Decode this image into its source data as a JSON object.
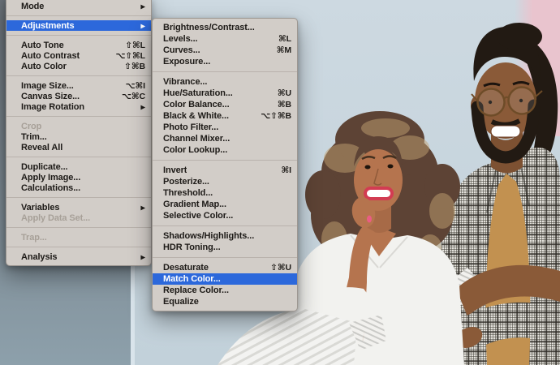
{
  "icons": {
    "submenu_arrow": "▶"
  },
  "palette": {
    "menu_bg": "#d2cdc8",
    "menu_text": "#1d1a17",
    "menu_disabled": "#a7a098",
    "menu_separator": "#b9b2ac",
    "menu_highlight": "#2c68db",
    "menu_highlight_text": "#ffffff",
    "wall_light": "#ccd8e0",
    "wall_dark_top": "#697077",
    "wall_dark_bottom": "#8da0ab",
    "wall_edge_light": "#dbe6ec",
    "wall_pink": "#e9c4ce",
    "skin_woman": "#b5744e",
    "skin_man": "#8a5a38",
    "hair_woman": "#5d4335",
    "hair_woman_highlight": "#c2a171",
    "hair_man": "#221a13",
    "shirt_tan": "#c29150",
    "blouse_white": "#f2f2ef",
    "lips_red": "#d23c52"
  },
  "left_menu": {
    "items": [
      {
        "label": "Mode",
        "submenu": true
      },
      {
        "sep": true
      },
      {
        "label": "Adjustments",
        "submenu": true,
        "highlighted": true
      },
      {
        "sep": true
      },
      {
        "label": "Auto Tone",
        "shortcut": "⇧⌘L"
      },
      {
        "label": "Auto Contrast",
        "shortcut": "⌥⇧⌘L"
      },
      {
        "label": "Auto Color",
        "shortcut": "⇧⌘B"
      },
      {
        "sep": true
      },
      {
        "label": "Image Size...",
        "shortcut": "⌥⌘I"
      },
      {
        "label": "Canvas Size...",
        "shortcut": "⌥⌘C"
      },
      {
        "label": "Image Rotation",
        "submenu": true
      },
      {
        "sep": true
      },
      {
        "label": "Crop",
        "disabled": true
      },
      {
        "label": "Trim..."
      },
      {
        "label": "Reveal All"
      },
      {
        "sep": true
      },
      {
        "label": "Duplicate..."
      },
      {
        "label": "Apply Image..."
      },
      {
        "label": "Calculations..."
      },
      {
        "sep": true
      },
      {
        "label": "Variables",
        "submenu": true
      },
      {
        "label": "Apply Data Set...",
        "disabled": true
      },
      {
        "sep": true
      },
      {
        "label": "Trap...",
        "disabled": true
      },
      {
        "sep": true
      },
      {
        "label": "Analysis",
        "submenu": true
      }
    ]
  },
  "submenu": {
    "items": [
      {
        "label": "Brightness/Contrast..."
      },
      {
        "label": "Levels...",
        "shortcut": "⌘L"
      },
      {
        "label": "Curves...",
        "shortcut": "⌘M"
      },
      {
        "label": "Exposure..."
      },
      {
        "sep": true
      },
      {
        "label": "Vibrance..."
      },
      {
        "label": "Hue/Saturation...",
        "shortcut": "⌘U"
      },
      {
        "label": "Color Balance...",
        "shortcut": "⌘B"
      },
      {
        "label": "Black & White...",
        "shortcut": "⌥⇧⌘B"
      },
      {
        "label": "Photo Filter..."
      },
      {
        "label": "Channel Mixer..."
      },
      {
        "label": "Color Lookup..."
      },
      {
        "sep": true
      },
      {
        "label": "Invert",
        "shortcut": "⌘I"
      },
      {
        "label": "Posterize..."
      },
      {
        "label": "Threshold..."
      },
      {
        "label": "Gradient Map..."
      },
      {
        "label": "Selective Color..."
      },
      {
        "sep": true
      },
      {
        "label": "Shadows/Highlights..."
      },
      {
        "label": "HDR Toning..."
      },
      {
        "sep": true
      },
      {
        "label": "Desaturate",
        "shortcut": "⇧⌘U"
      },
      {
        "label": "Match Color...",
        "highlighted": true
      },
      {
        "label": "Replace Color..."
      },
      {
        "label": "Equalize"
      }
    ]
  }
}
